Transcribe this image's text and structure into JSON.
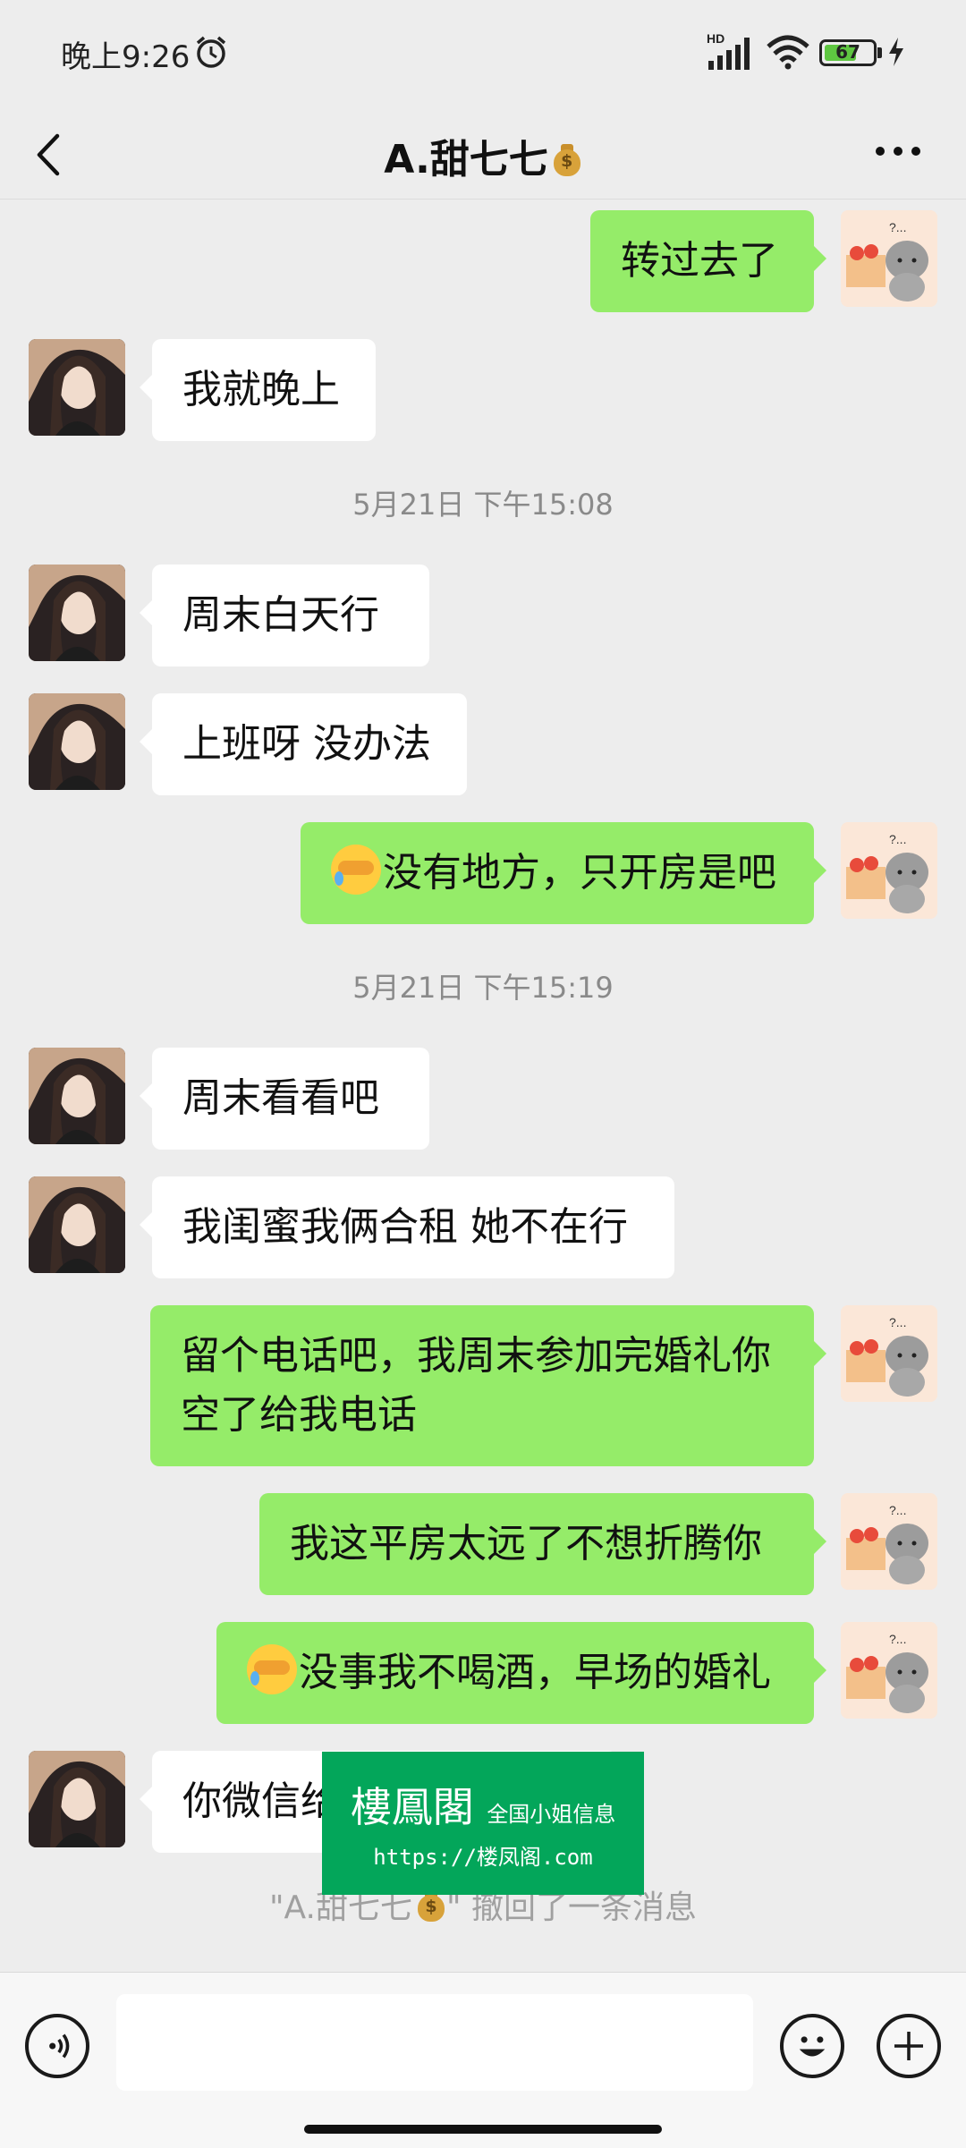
{
  "status_bar": {
    "time": "晚上9:26",
    "battery_percent": "67",
    "battery_level": 0.67
  },
  "header": {
    "title": "A.甜七七",
    "title_emoji": "money-bag-icon"
  },
  "messages": [
    {
      "side": "out",
      "text": "转过去了"
    },
    {
      "side": "in",
      "text": "我就晚上"
    },
    {
      "type": "time",
      "text": "5月21日 下午15:08"
    },
    {
      "side": "in",
      "text": "周末白天行"
    },
    {
      "side": "in",
      "text": "上班呀 没办法"
    },
    {
      "side": "out",
      "emoji": "face-palm-emoji",
      "text": "没有地方，只开房是吧"
    },
    {
      "type": "time",
      "text": "5月21日 下午15:19"
    },
    {
      "side": "in",
      "text": "周末看看吧"
    },
    {
      "side": "in",
      "text": "我闺蜜我俩合租 她不在行"
    },
    {
      "side": "out",
      "text": "留个电话吧，我周末参加完婚礼你空了给我电话"
    },
    {
      "side": "out",
      "text": "我这平房太远了不想折腾你"
    },
    {
      "side": "out",
      "emoji": "face-palm-emoji",
      "text": "没事我不喝酒，早场的婚礼"
    },
    {
      "side": "in",
      "text": "你微信给"
    }
  ],
  "recall_notice": {
    "prefix": "\"A.甜七七",
    "suffix": "\" 撤回了一条消息"
  },
  "ad_banner": {
    "title": "樓鳳閣",
    "subtitle": "全国小姐信息",
    "url": "https://楼凤阁.com"
  },
  "input_bar": {
    "placeholder": ""
  },
  "colors": {
    "background": "#ededed",
    "outgoing_bubble": "#95ec69",
    "incoming_bubble": "#ffffff",
    "ad_green": "#03a65a"
  }
}
